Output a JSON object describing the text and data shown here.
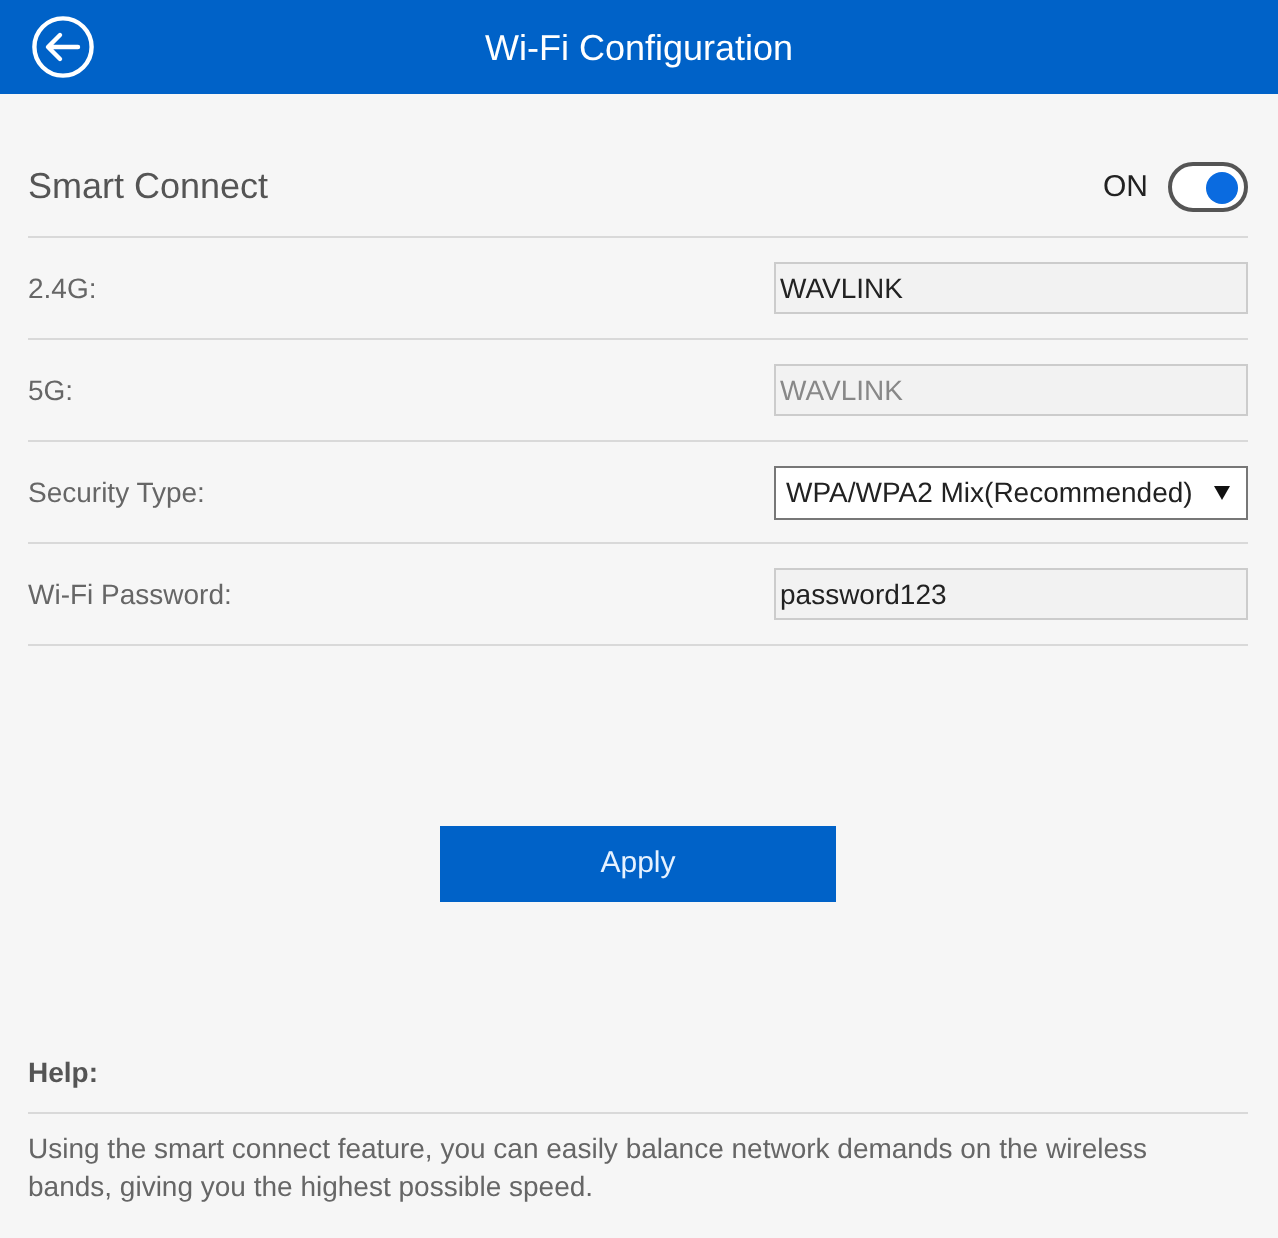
{
  "header": {
    "title": "Wi-Fi Configuration"
  },
  "smart_connect": {
    "label": "Smart Connect",
    "state_label": "ON",
    "on": true
  },
  "fields": [
    {
      "kind": "input",
      "label": "2.4G:",
      "value": "WAVLINK",
      "disabled": false
    },
    {
      "kind": "input",
      "label": "5G:",
      "value": "WAVLINK",
      "disabled": true
    },
    {
      "kind": "select",
      "label": "Security Type:",
      "value": "WPA/WPA2 Mix(Recommended)"
    },
    {
      "kind": "input",
      "label": "Wi-Fi Password:",
      "value": "password123",
      "disabled": false
    }
  ],
  "apply_button": {
    "label": "Apply"
  },
  "help": {
    "title": "Help:",
    "text": "Using the smart connect feature, you can easily balance network demands on the wireless bands, giving you the highest possible speed."
  }
}
